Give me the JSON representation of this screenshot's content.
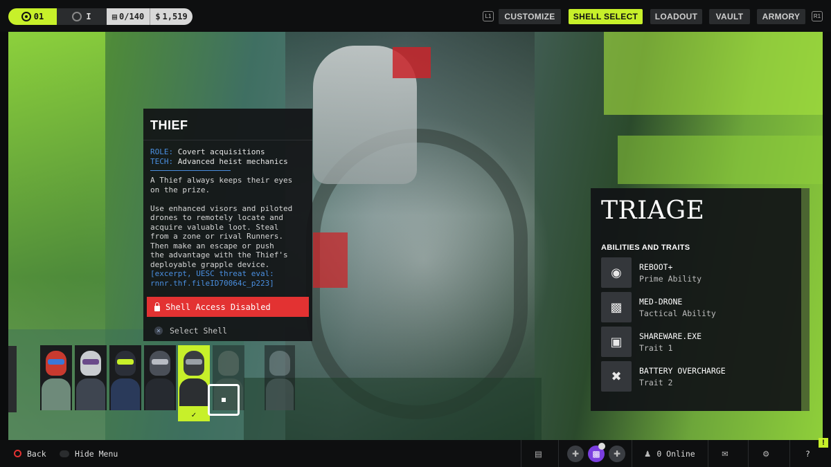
{
  "header": {
    "level": "01",
    "rank": "I",
    "stash": "0/140",
    "credits": "1,519",
    "bumper_left": "L1",
    "bumper_right": "R1",
    "nav": [
      "CUSTOMIZE",
      "SHELL SELECT",
      "LOADOUT",
      "VAULT",
      "ARMORY"
    ],
    "active_nav": "SHELL SELECT"
  },
  "shell_info": {
    "name": "THIEF",
    "role_key": "ROLE:",
    "role_value": "Covert acquisitions",
    "tech_key": "TECH:",
    "tech_value": "Advanced heist mechanics",
    "body_1": "A Thief always keeps their eyes\non the prize.",
    "body_2": "Use enhanced visors and piloted\ndrones to remotely locate and\nacquire valuable loot. Steal\nfrom a zone or rival Runners.\nThen make an escape or push\nthe advantage with the Thief's\ndeployable grapple device.",
    "reference": "[excerpt, UESC threat eval:\nrnnr.thf.fileID70064c_p223]",
    "status": "Shell Access Disabled",
    "select_label": "Select Shell"
  },
  "roster": [
    {
      "name": "shell-1",
      "state": "available"
    },
    {
      "name": "shell-2",
      "state": "available"
    },
    {
      "name": "shell-3",
      "state": "available"
    },
    {
      "name": "shell-4",
      "state": "available"
    },
    {
      "name": "shell-5",
      "state": "selected"
    },
    {
      "name": "shell-6",
      "state": "hovered"
    },
    {
      "name": "shell-7",
      "state": "locked"
    }
  ],
  "selected_shell": {
    "name": "TRIAGE",
    "section_title": "ABILITIES AND TRAITS",
    "abilities": [
      {
        "name": "REBOOT+",
        "type": "Prime Ability",
        "icon": "drone-network-icon"
      },
      {
        "name": "MED-DRONE",
        "type": "Tactical Ability",
        "icon": "med-drone-icon"
      },
      {
        "name": "SHAREWARE.EXE",
        "type": "Trait 1",
        "icon": "shareware-icon"
      },
      {
        "name": "BATTERY OVERCHARGE",
        "type": "Trait 2",
        "icon": "battery-overcharge-icon"
      }
    ]
  },
  "footer": {
    "back_label": "Back",
    "hide_menu_label": "Hide Menu",
    "online_label": "0 Online",
    "help_label": "?"
  },
  "colors": {
    "accent": "#c7f02a",
    "danger": "#e33232",
    "link_blue": "#4a8fe0",
    "party_purple": "#7b3fe0"
  }
}
